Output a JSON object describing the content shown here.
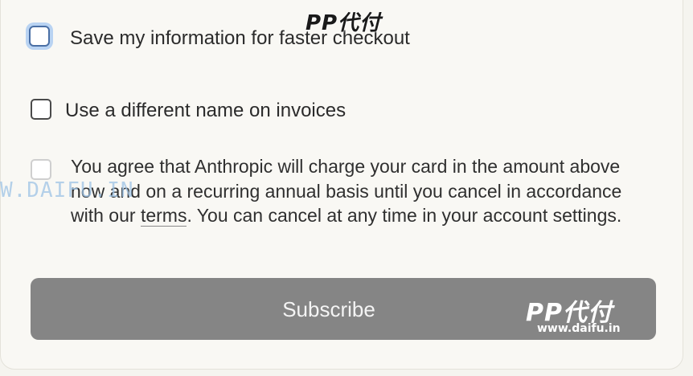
{
  "options": {
    "save_info_label": "Save my information for faster checkout",
    "different_name_label": "Use a different name on invoices"
  },
  "agreement": {
    "text_before_link": "You agree that Anthropic will charge your card in the amount above now and on a recurring annual basis until you cancel in accordance with our ",
    "terms_link": "terms",
    "text_after_link": ". You can cancel at any time in your account settings."
  },
  "subscribe_button": {
    "label": "Subscribe"
  },
  "watermarks": {
    "logo_text": "PP代付",
    "url_text": "www.daifu.in",
    "side_text": "W.DAIFU.IN"
  },
  "colors": {
    "button_bg": "#858585",
    "focus_ring": "#b9d3f2",
    "card_bg": "#f9f8f4"
  }
}
